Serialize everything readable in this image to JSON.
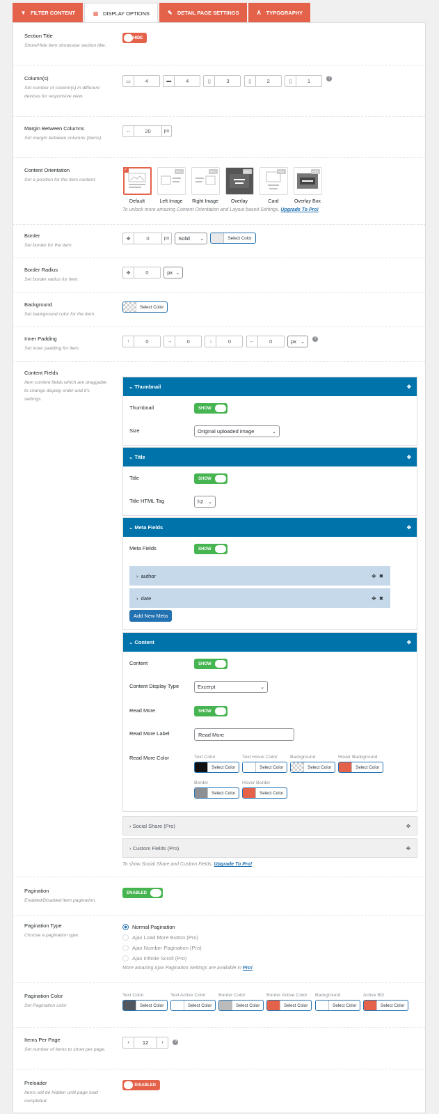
{
  "tabs": [
    {
      "label": "FILTER CONTENT",
      "icon": "filter-icon"
    },
    {
      "label": "DISPLAY OPTIONS",
      "icon": "grid-icon"
    },
    {
      "label": "DETAIL PAGE SETTINGS",
      "icon": "edit-icon"
    },
    {
      "label": "TYPOGRAPHY",
      "icon": "text-icon"
    }
  ],
  "section_title": {
    "label": "Section Title",
    "desc": "Show/Hide item showcase section title.",
    "toggle": "HIDE"
  },
  "columns": {
    "label": "Column(s)",
    "desc": "Set number of column(s) in different devices for responsive view.",
    "values": [
      "4",
      "4",
      "3",
      "2",
      "1"
    ],
    "icons": [
      "large-desktop-icon",
      "desktop-icon",
      "tablet-icon",
      "tablet-small-icon",
      "mobile-icon"
    ]
  },
  "margin": {
    "label": "Margin Between Columns",
    "desc": "Set margin between columns (items).",
    "value": "20",
    "unit": "px"
  },
  "orientation": {
    "label": "Content Orientation",
    "desc": "Set a position for the item content.",
    "options": [
      "Default",
      "Left Image",
      "Right Image",
      "Overlay",
      "Card",
      "Overlay Box"
    ],
    "pro_badge": "PRO",
    "note": "To unlock more amazing Content Orientation and Layout based Settings,",
    "link": "Upgrade To Pro!"
  },
  "border": {
    "label": "Border",
    "desc": "Set border for the item.",
    "value": "0",
    "unit": "px",
    "style": "Solid",
    "color_btn": "Select Color"
  },
  "border_radius": {
    "label": "Border Radius",
    "desc": "Set border radius for item.",
    "value": "0",
    "unit": "px"
  },
  "background": {
    "label": "Background",
    "desc": "Set background color for the item.",
    "color_btn": "Select Color"
  },
  "inner_padding": {
    "label": "Inner Padding",
    "desc": "Set inner padding for item.",
    "values": [
      "0",
      "0",
      "0",
      "0"
    ],
    "unit": "px"
  },
  "content_fields": {
    "label": "Content Fields",
    "desc": "Item content fields which are draggable to change display order and it's settings.",
    "thumbnail": {
      "title": "Thumbnail",
      "row1": "Thumbnail",
      "row1_toggle": "SHOW",
      "row2": "Size",
      "size": "Original uploaded image"
    },
    "title": {
      "title": "Title",
      "row1": "Title",
      "row1_toggle": "SHOW",
      "row2": "Title HTML Tag",
      "tag": "h2"
    },
    "meta": {
      "title": "Meta Fields",
      "row1": "Meta Fields",
      "row1_toggle": "SHOW",
      "items": [
        "author",
        "date"
      ],
      "add_btn": "Add New Meta"
    },
    "content": {
      "title": "Content",
      "row1": "Content",
      "row1_toggle": "SHOW",
      "row2": "Content Display Type",
      "display_type": "Excerpt",
      "row3": "Read More",
      "row3_toggle": "SHOW",
      "row4": "Read More Label",
      "read_more_label": "Read More",
      "row5": "Read More Color",
      "colors": [
        {
          "label": "Text Color",
          "swatch": "#111111",
          "btn": "Select Color"
        },
        {
          "label": "Text Hover Color",
          "swatch": "#ffffff",
          "btn": "Select Color"
        },
        {
          "label": "Background",
          "swatch": "checker",
          "btn": "Select Color"
        },
        {
          "label": "Hover Background",
          "swatch": "#e4614a",
          "btn": "Select Color"
        },
        {
          "label": "Border",
          "swatch": "#8c8f94",
          "btn": "Select Color"
        },
        {
          "label": "Hover Border",
          "swatch": "#e4614a",
          "btn": "Select Color"
        }
      ]
    },
    "pro_items": [
      "Social Share (Pro)",
      "Custom Fields (Pro)"
    ],
    "note": "To show Social Share and Custom Fields,",
    "link": "Upgrade To Pro!"
  },
  "pagination": {
    "label": "Pagination",
    "desc": "Enabled/Disabled item pagination.",
    "toggle": "ENABLED"
  },
  "pagination_type": {
    "label": "Pagination Type",
    "desc": "Choose a pagination type.",
    "options": [
      "Normal Pagination",
      "Ajax Load More Button (Pro)",
      "Ajax Number Pagination (Pro)",
      "Ajax Infinite Scroll (Pro)"
    ],
    "note": "More amazing Ajax Pagination Settings are available in",
    "link": "Pro!"
  },
  "pagination_color": {
    "label": "Pagination Color",
    "desc": "Set Pagination color",
    "colors": [
      {
        "label": "Text Color",
        "swatch": "#50575e",
        "btn": "Select Color"
      },
      {
        "label": "Text Active Color",
        "swatch": "#ffffff",
        "btn": "Select Color"
      },
      {
        "label": "Border Color",
        "swatch": "#bbbbbb",
        "btn": "Select Color"
      },
      {
        "label": "Border Active Color",
        "swatch": "#e4614a",
        "btn": "Select Color"
      },
      {
        "label": "Background",
        "swatch": "#ffffff",
        "btn": "Select Color"
      },
      {
        "label": "Active BG",
        "swatch": "#e4614a",
        "btn": "Select Color"
      }
    ]
  },
  "items_per_page": {
    "label": "Items Per Page",
    "desc": "Set number of items to show per page.",
    "value": "12"
  },
  "preloader": {
    "label": "Preloader",
    "desc": "Items will be hidden until page load completed.",
    "toggle": "DISABLED"
  }
}
